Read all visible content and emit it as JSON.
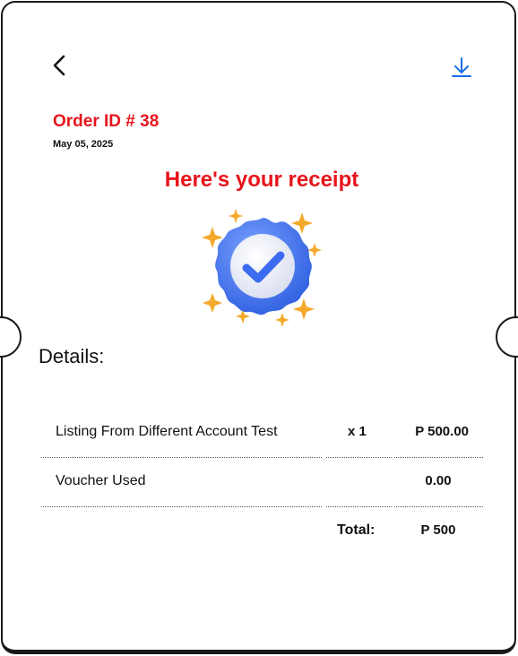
{
  "header": {
    "back_icon": "chevron-left-icon",
    "download_icon": "download-icon",
    "accent_color": "#e8141b",
    "link_color": "#1a6fe8"
  },
  "order": {
    "id_label": "Order ID # 38",
    "date": "May 05, 2025"
  },
  "receipt": {
    "title": "Here's your receipt",
    "badge_icon": "verified-badge-icon"
  },
  "details": {
    "title": "Details:",
    "items": [
      {
        "name": "Listing From Different Account Test",
        "qty": "x 1",
        "price": "P 500.00"
      }
    ],
    "voucher": {
      "label": "Voucher Used",
      "amount": "0.00"
    },
    "total": {
      "label": "Total:",
      "amount": "P 500"
    }
  }
}
